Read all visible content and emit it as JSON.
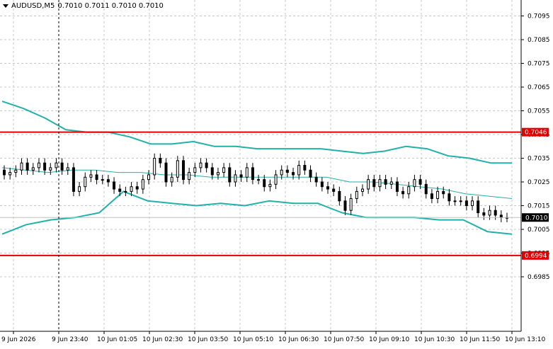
{
  "header": {
    "symbol": "AUDUSD,M5",
    "ohlc": "0.7010 0.7011 0.7010 0.7010"
  },
  "colors": {
    "background": "#ffffff",
    "grid": "#c8c8c8",
    "candle": "#000000",
    "bands": "#20b2aa",
    "level_line": "#e00000",
    "current_price_bg": "#000000"
  },
  "price_axis": {
    "labels": [
      "0.7095",
      "0.7085",
      "0.7075",
      "0.7065",
      "0.7055",
      "0.7045",
      "0.7035",
      "0.7025",
      "0.7015",
      "0.7005",
      "0.6995",
      "0.6985"
    ],
    "current_price": "0.7010",
    "levels": [
      "0.7046",
      "0.6994"
    ]
  },
  "time_axis": {
    "labels": [
      "9 Jun 2026",
      "9 Jun 23:40",
      "10 Jun 01:05",
      "10 Jun 02:30",
      "10 Jun 03:50",
      "10 Jun 05:10",
      "10 Jun 06:30",
      "10 Jun 07:50",
      "10 Jun 09:10",
      "10 Jun 10:30",
      "10 Jun 11:50",
      "10 Jun 13:10"
    ]
  },
  "chart_data": {
    "type": "candlestick",
    "symbol": "AUDUSD",
    "timeframe": "M5",
    "ylim": [
      0.6981,
      0.7102
    ],
    "x": [
      "9 Jun 2026",
      "9 Jun 23:40",
      "10 Jun 01:05",
      "10 Jun 02:30",
      "10 Jun 03:50",
      "10 Jun 05:10",
      "10 Jun 06:30",
      "10 Jun 07:50",
      "10 Jun 09:10",
      "10 Jun 10:30",
      "10 Jun 11:50",
      "10 Jun 13:10"
    ],
    "close": [
      0.7028,
      0.7029,
      0.703,
      0.7033,
      0.703,
      0.7031,
      0.7033,
      0.703,
      0.7031,
      0.7033,
      0.703,
      0.7031,
      0.7021,
      0.7023,
      0.7027,
      0.7028,
      0.7026,
      0.7026,
      0.7025,
      0.7022,
      0.7021,
      0.7021,
      0.7023,
      0.7022,
      0.7026,
      0.7028,
      0.7035,
      0.7033,
      0.7025,
      0.7027,
      0.7034,
      0.7026,
      0.7029,
      0.7031,
      0.7033,
      0.7031,
      0.7028,
      0.7029,
      0.7031,
      0.7025,
      0.7028,
      0.7027,
      0.7031,
      0.7026,
      0.7026,
      0.7023,
      0.7024,
      0.7028,
      0.703,
      0.7029,
      0.7028,
      0.7032,
      0.703,
      0.7027,
      0.7025,
      0.7023,
      0.7022,
      0.7021,
      0.7017,
      0.7013,
      0.7018,
      0.7021,
      0.7022,
      0.7026,
      0.7023,
      0.7026,
      0.7024,
      0.7025,
      0.7021,
      0.702,
      0.7023,
      0.7026,
      0.7024,
      0.702,
      0.7018,
      0.7021,
      0.702,
      0.7017,
      0.7017,
      0.7017,
      0.7015,
      0.7017,
      0.7012,
      0.7011,
      0.7013,
      0.7011,
      0.701,
      0.701
    ],
    "upper_band": [
      0.7059,
      0.7056,
      0.7052,
      0.7047,
      0.7046,
      0.7046,
      0.7044,
      0.7041,
      0.7041,
      0.7042,
      0.704,
      0.704,
      0.7039,
      0.7039,
      0.7039,
      0.7039,
      0.7038,
      0.7037,
      0.7038,
      0.704,
      0.7039,
      0.7036,
      0.7035,
      0.7033,
      0.7033
    ],
    "middle_band": [
      0.7031,
      0.703,
      0.7029,
      0.703,
      0.703,
      0.7029,
      0.7029,
      0.7028,
      0.7028,
      0.7027,
      0.7027,
      0.7027,
      0.7027,
      0.7027,
      0.7027,
      0.7025,
      0.7025,
      0.7024,
      0.7023,
      0.7022,
      0.702,
      0.7019,
      0.7018
    ],
    "lower_band": [
      0.7003,
      0.7007,
      0.7009,
      0.701,
      0.7012,
      0.7021,
      0.7017,
      0.7016,
      0.7015,
      0.7016,
      0.7015,
      0.7017,
      0.7016,
      0.7016,
      0.7012,
      0.701,
      0.701,
      0.701,
      0.7009,
      0.7009,
      0.7004,
      0.7003
    ],
    "horizontal_levels": [
      0.7046,
      0.6994
    ],
    "current_price": 0.701,
    "grid": true
  }
}
